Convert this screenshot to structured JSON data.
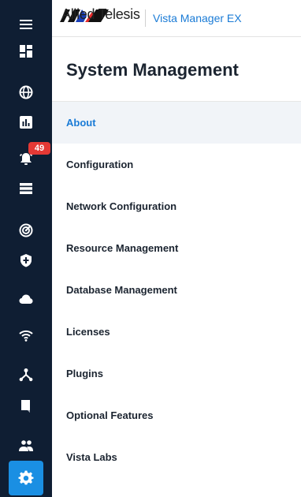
{
  "header": {
    "brand": "Allied Telesis",
    "product": "Vista Manager EX"
  },
  "page": {
    "title": "System Management"
  },
  "rail": {
    "alerts_badge": "49",
    "icons": [
      "menu-icon",
      "dashboard-icon",
      "globe-icon",
      "chart-icon",
      "alarm-icon",
      "list-icon",
      "radar-icon",
      "shield-icon",
      "cloud-icon",
      "wifi-icon",
      "network-icon",
      "bookmark-icon",
      "users-icon",
      "gear-icon"
    ],
    "active_icon": "gear-icon"
  },
  "menu": {
    "items": [
      "About",
      "Configuration",
      "Network Configuration",
      "Resource Management",
      "Database Management",
      "Licenses",
      "Plugins",
      "Optional Features",
      "Vista Labs"
    ],
    "active": "About"
  },
  "colors": {
    "rail_bg": "#0f1e33",
    "accent": "#1a8fe3",
    "link": "#1a7bd6",
    "badge": "#e53935"
  }
}
